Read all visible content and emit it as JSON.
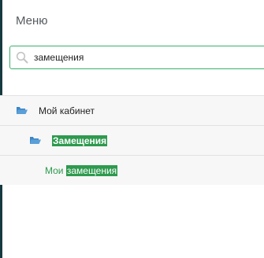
{
  "menu": {
    "title": "Меню"
  },
  "search": {
    "value": "замещения",
    "icon": "search-icon"
  },
  "tree": {
    "items": [
      {
        "label": "Мой кабинет",
        "icon": "folder-open-icon",
        "level": 1
      },
      {
        "label_highlight": "Замещения",
        "icon": "folder-open-icon",
        "level": 2
      },
      {
        "label_prefix": "Мои ",
        "label_highlight": "замещения",
        "level": 3
      }
    ]
  },
  "colors": {
    "accent": "#2e9a4e",
    "folder": "#3d86c6",
    "search_border": "#39b06a"
  }
}
